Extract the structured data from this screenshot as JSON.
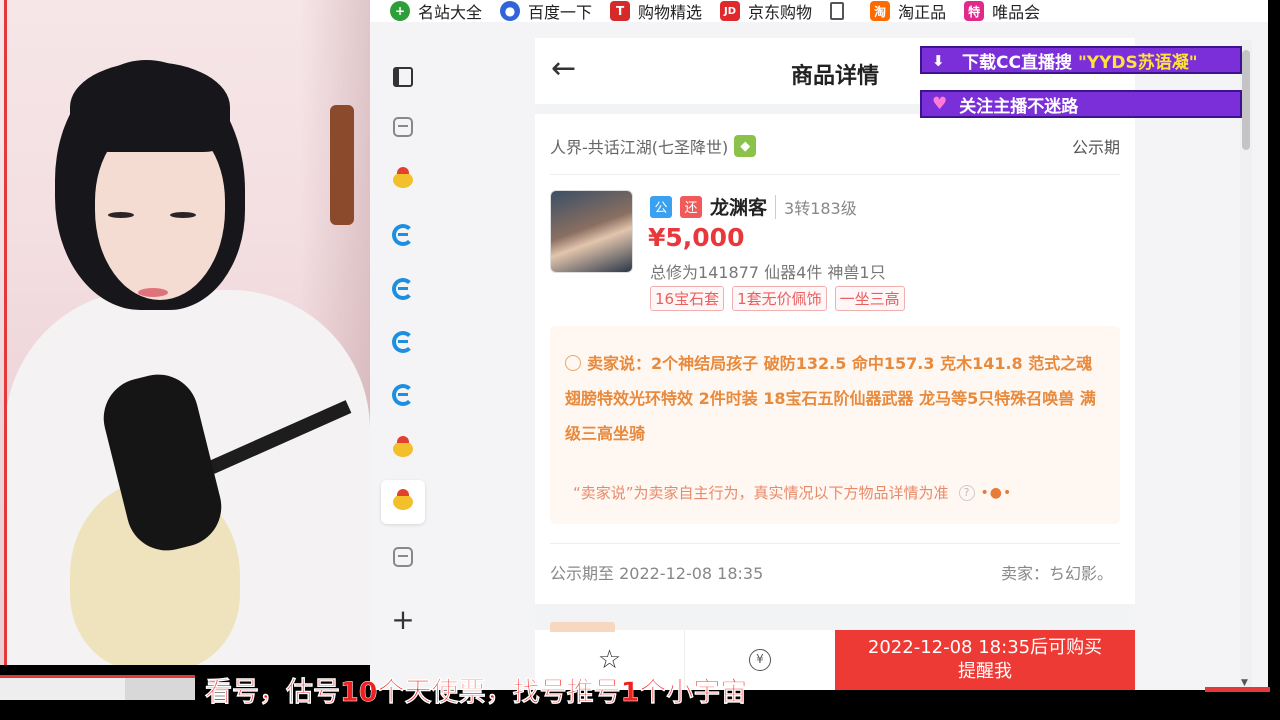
{
  "bookmarks": [
    {
      "label": "名站大全",
      "icon": "plus-circle-icon",
      "color": "#2e9e3a"
    },
    {
      "label": "百度一下",
      "icon": "baidu-paw-icon",
      "color": "#3164d8"
    },
    {
      "label": "购物精选",
      "icon": "t-letter-icon",
      "color": "#d42a2a"
    },
    {
      "label": "京东购物",
      "icon": "jd-icon",
      "color": "#e0292b"
    },
    {
      "label": "",
      "icon": "document-icon",
      "color": "#555555"
    },
    {
      "label": "淘正品",
      "icon": "taobao-icon",
      "color": "#ff6a00"
    },
    {
      "label": "唯品会",
      "icon": "vip-icon",
      "color": "#e0298a"
    }
  ],
  "page": {
    "title": "商品详情",
    "server": "人界-共话江湖(七圣降世)",
    "period_label": "公示期",
    "role_name": "龙渊客",
    "tag_public": "公",
    "tag_return": "还",
    "level": "3转183级",
    "price": "¥5,000",
    "stats": "总修为141877  仙器4件  神兽1只",
    "chips": [
      "16宝石套",
      "1套无价佩饰",
      "一坐三高"
    ],
    "seller_says_label": "卖家说：",
    "seller_says": "2个神结局孩子 破防132.5 命中157.3 克木141.8 范式之魂 翅膀特效光环特效 2件时装 18宝石五阶仙器武器 龙马等5只特殊召唤兽 满级三高坐骑",
    "disclaimer": "“卖家说”为卖家自主行为，真实情况以下方物品详情为准",
    "public_until": "公示期至 2022-12-08 18:35",
    "seller": "卖家：ち幻影。",
    "bargain_label": "还",
    "remind_line1": "2022-12-08 18:35后可购买",
    "remind_line2": "提醒我"
  },
  "overlays": {
    "download_prefix": "下载CC直播搜",
    "download_highlight": "\"YYDS苏语凝\"",
    "follow": "关注主播不迷路",
    "subtitle": "看号，估号10个天使票，找号推号1个小宇宙"
  },
  "colors": {
    "price": "#e8383b",
    "accent_button": "#ee3a35",
    "seller_box_text": "#e88a3d",
    "banner": "#7b2fd8"
  }
}
